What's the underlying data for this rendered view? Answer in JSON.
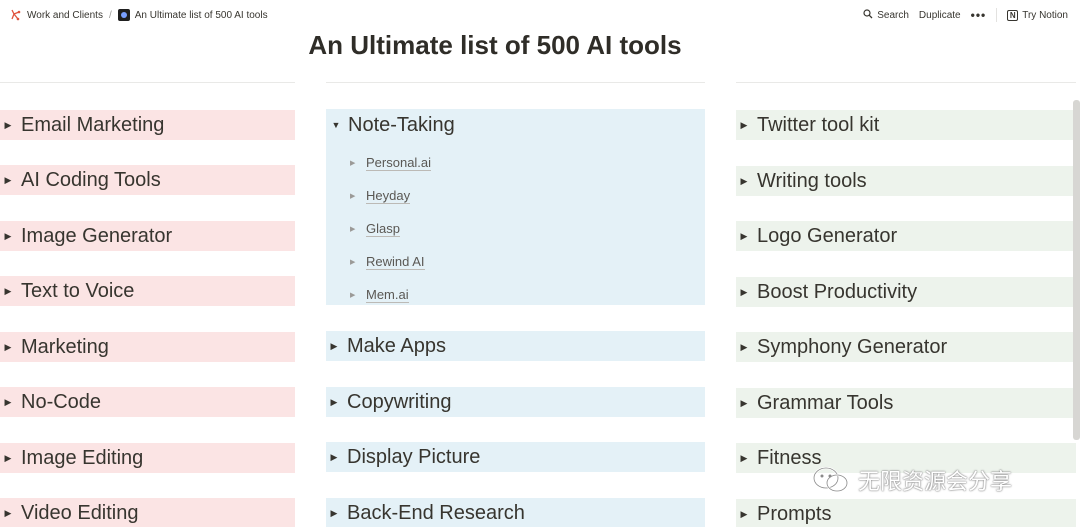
{
  "breadcrumbs": [
    {
      "label": "Work and Clients",
      "icon": "notebook-icon"
    },
    {
      "label": "An Ultimate list of 500 AI tools",
      "icon": "page-icon"
    }
  ],
  "topbar": {
    "search_label": "Search",
    "duplicate_label": "Duplicate",
    "more_label": "•••",
    "try_notion_label": "Try Notion"
  },
  "page": {
    "title": "An Ultimate list of 500 AI tools"
  },
  "columns": {
    "left": [
      {
        "label": "Email Marketing",
        "color": "#fbe4e4"
      },
      {
        "label": "AI Coding Tools",
        "color": "#fbe4e4"
      },
      {
        "label": "Image Generator",
        "color": "#fbe4e4"
      },
      {
        "label": "Text to Voice",
        "color": "#fbe4e4"
      },
      {
        "label": "Marketing",
        "color": "#fbe4e4"
      },
      {
        "label": "No-Code",
        "color": "#fbe4e4"
      },
      {
        "label": "Image Editing",
        "color": "#fbe4e4"
      },
      {
        "label": "Video Editing",
        "color": "#fbe4e4"
      }
    ],
    "middle": {
      "expanded": {
        "label": "Note-Taking",
        "children": [
          "Personal.ai",
          "Heyday",
          "Glasp",
          "Rewind AI",
          "Mem.ai"
        ]
      },
      "items": [
        {
          "label": "Make Apps"
        },
        {
          "label": "Copywriting"
        },
        {
          "label": "Display Picture"
        },
        {
          "label": "Back-End Research"
        }
      ]
    },
    "right": [
      {
        "label": "Twitter tool kit",
        "color": "#edf3ec"
      },
      {
        "label": "Writing tools",
        "color": "#edf3ec"
      },
      {
        "label": "Logo Generator",
        "color": "#edf3ec"
      },
      {
        "label": "Boost Productivity",
        "color": "#edf3ec"
      },
      {
        "label": "Symphony Generator",
        "color": "#edf3ec"
      },
      {
        "label": "Grammar Tools",
        "color": "#edf3ec"
      },
      {
        "label": "Fitness",
        "color": "#edf3ec"
      },
      {
        "label": "Prompts",
        "color": "#edf3ec"
      }
    ]
  },
  "watermark": {
    "text": "无限资源会分享",
    "icon": "wechat-icon"
  }
}
